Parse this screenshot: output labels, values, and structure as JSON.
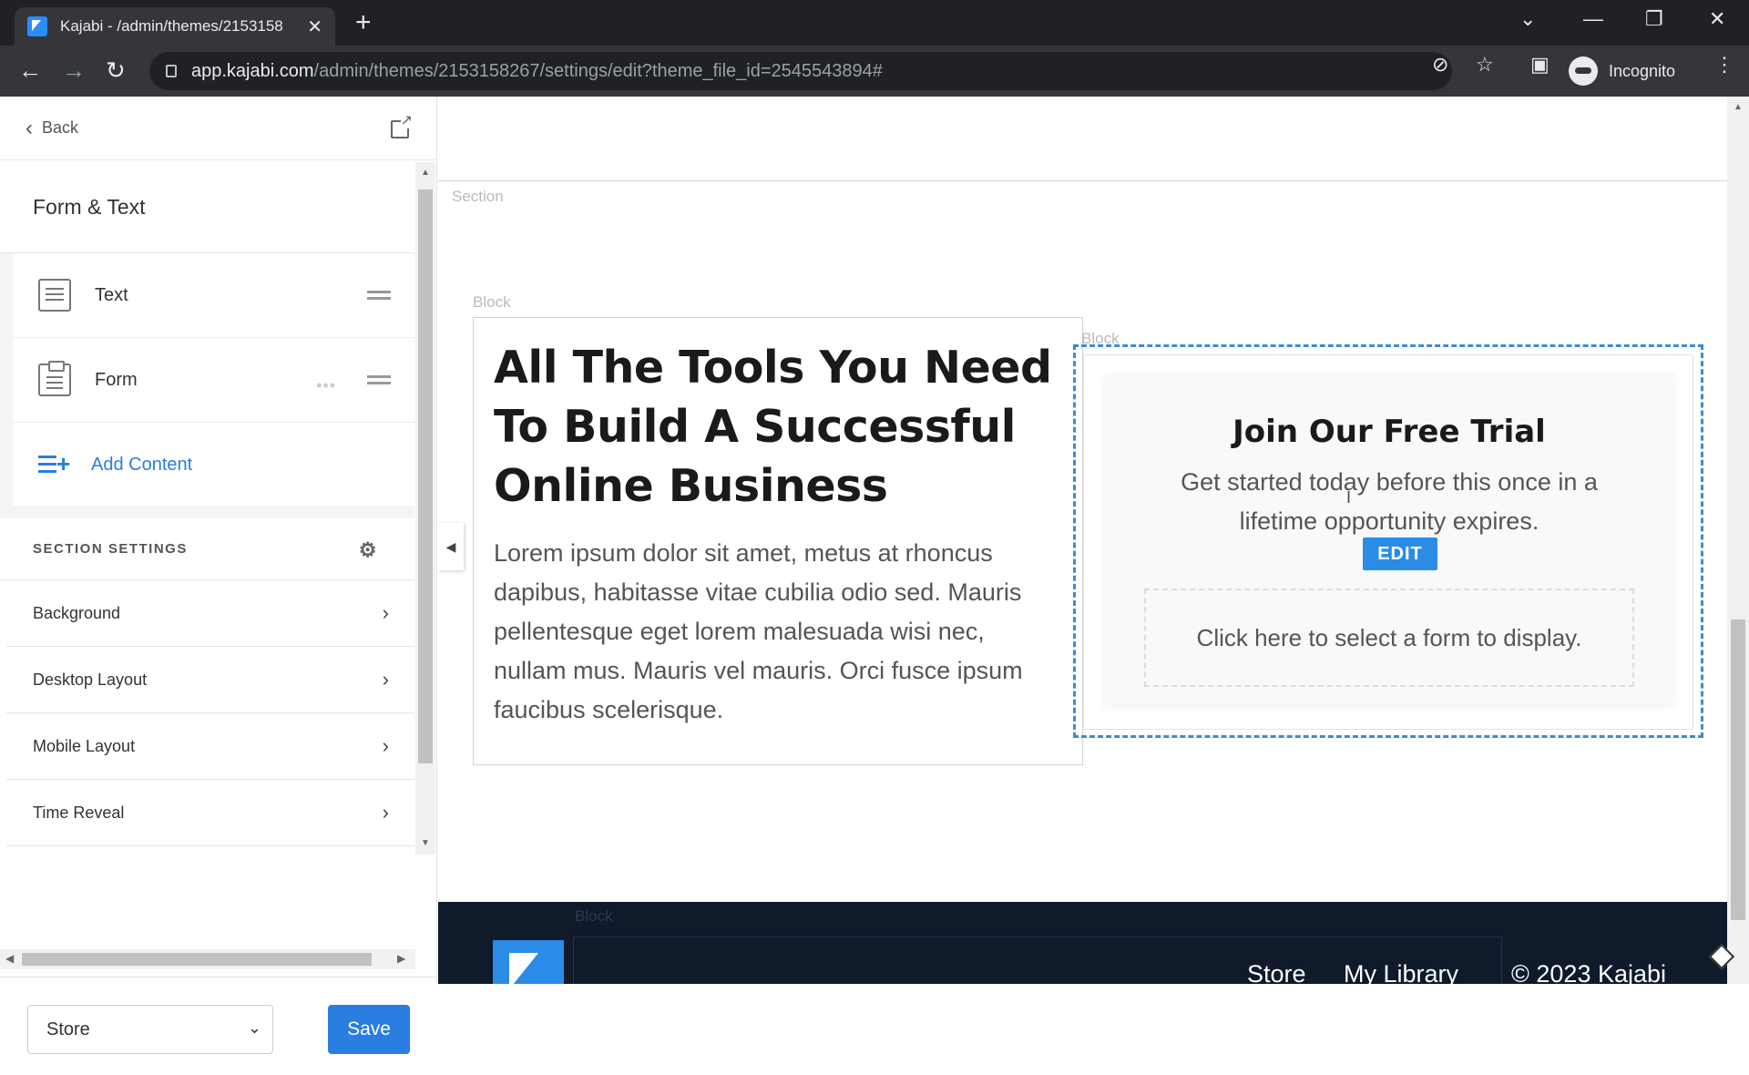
{
  "browser": {
    "tab_title": "Kajabi - /admin/themes/2153158",
    "url_host": "app.kajabi.com",
    "url_path": "/admin/themes/2153158267/settings/edit?theme_file_id=2545543894#",
    "profile_label": "Incognito"
  },
  "sidebar": {
    "back_label": "Back",
    "panel_title": "Form & Text",
    "content_items": [
      {
        "label": "Text",
        "icon": "text-block-icon"
      },
      {
        "label": "Form",
        "icon": "form-clipboard-icon"
      }
    ],
    "add_content_label": "Add Content",
    "section_settings_title": "SECTION SETTINGS",
    "settings": [
      "Background",
      "Desktop Layout",
      "Mobile Layout",
      "Time Reveal"
    ],
    "store_select_value": "Store",
    "save_label": "Save"
  },
  "preview": {
    "section_label": "Section",
    "block_label": "Block",
    "hero_title": "All The Tools You Need To Build A Successful Online Business",
    "hero_body": "Lorem ipsum dolor sit amet, metus at rhoncus dapibus, habitasse vitae cubilia odio sed. Mauris pellentesque eget lorem malesuada wisi nec, nullam mus. Mauris vel mauris. Orci fusce ipsum faucibus scelerisque.",
    "trial_title": "Join Our Free Trial",
    "trial_subtitle": "Get started today before this once in a lifetime opportunity expires.",
    "edit_badge": "EDIT",
    "form_placeholder": "Click here to select a form to display.",
    "footer_links": [
      "Store",
      "My Library"
    ],
    "footer_copyright": "© 2023 Kajabi"
  },
  "colors": {
    "accent": "#2a7de1",
    "dashed_selection": "#3f8ad6",
    "footer_bg": "#0f1a2b"
  }
}
